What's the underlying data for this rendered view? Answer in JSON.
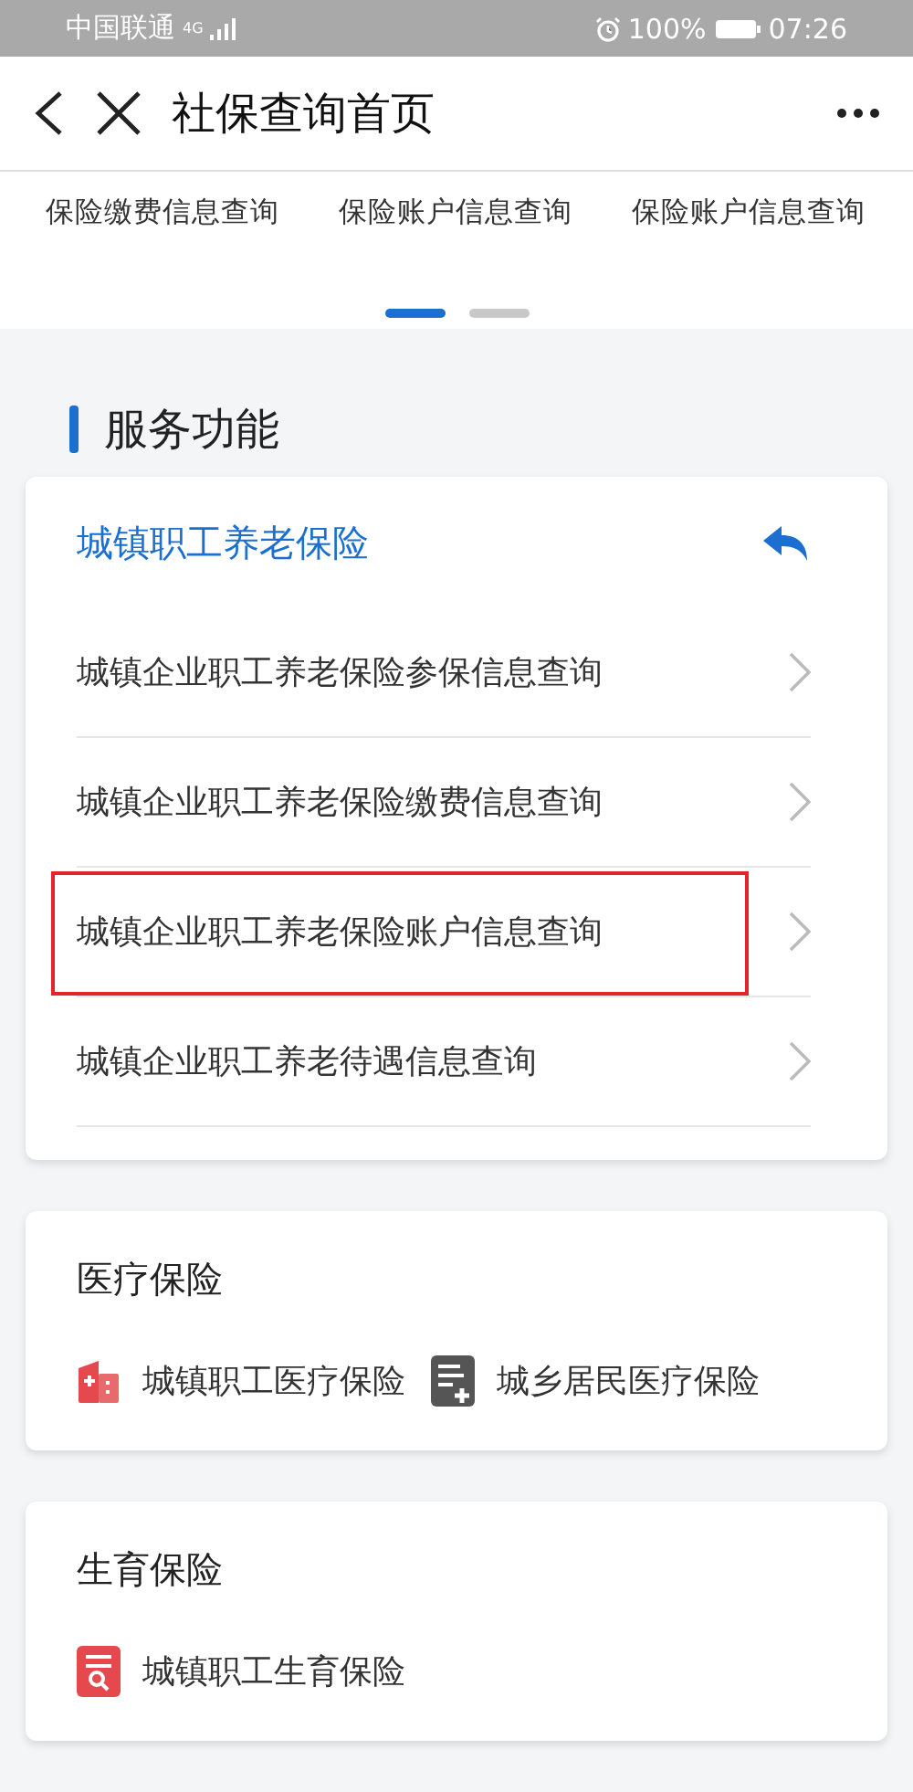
{
  "status_bar": {
    "carrier": "中国联通",
    "network": "4G",
    "battery": "100%",
    "time": "07:26"
  },
  "header": {
    "title": "社保查询首页"
  },
  "carousel": {
    "items": [
      "保险缴费信息查询",
      "保险账户信息查询",
      "保险账户信息查询"
    ],
    "dots": [
      {
        "selected": true
      },
      {
        "selected": false
      }
    ]
  },
  "section_title": "服务功能",
  "pension_card": {
    "title": "城镇职工养老保险",
    "rows": [
      {
        "label": "城镇企业职工养老保险参保信息查询",
        "highlighted": false
      },
      {
        "label": "城镇企业职工养老保险缴费信息查询",
        "highlighted": false
      },
      {
        "label": "城镇企业职工养老保险账户信息查询",
        "highlighted": true
      },
      {
        "label": "城镇企业职工养老待遇信息查询",
        "highlighted": false
      }
    ]
  },
  "cards": [
    {
      "title": "医疗保险",
      "items": [
        {
          "label": "城镇职工医疗保险",
          "kind": "hospital"
        },
        {
          "label": "城乡居民医疗保险",
          "kind": "document"
        }
      ]
    },
    {
      "title": "生育保险",
      "items": [
        {
          "label": "城镇职工生育保险",
          "kind": "search"
        }
      ]
    }
  ]
}
